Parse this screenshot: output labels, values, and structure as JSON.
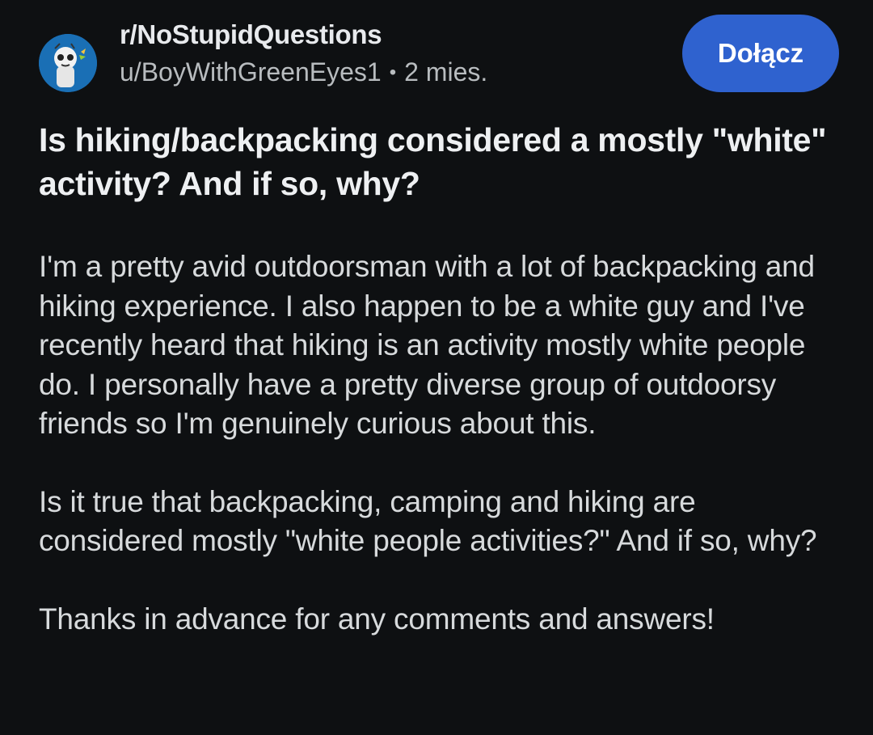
{
  "post": {
    "subreddit": "r/NoStupidQuestions",
    "author": "u/BoyWithGreenEyes1",
    "separator": "•",
    "time": "2 mies.",
    "join_label": "Dołącz",
    "title": "Is hiking/backpacking considered a mostly \"white\" activity? And if so, why?",
    "paragraphs": [
      "I'm a pretty avid outdoorsman with a lot of backpacking and hiking experience. I also happen to be a white guy and I've recently heard that hiking is an activity mostly white people do. I personally have a pretty diverse group of outdoorsy friends so I'm genuinely curious about this.",
      "Is it true that backpacking, camping and hiking are considered mostly \"white people activities?\" And if so, why?",
      "Thanks in advance for any comments and answers!"
    ]
  },
  "colors": {
    "background": "#0e1012",
    "join_button": "#2f62cf",
    "text": "#d7dadc"
  },
  "icons": {
    "avatar": "subreddit-avatar-icon"
  }
}
